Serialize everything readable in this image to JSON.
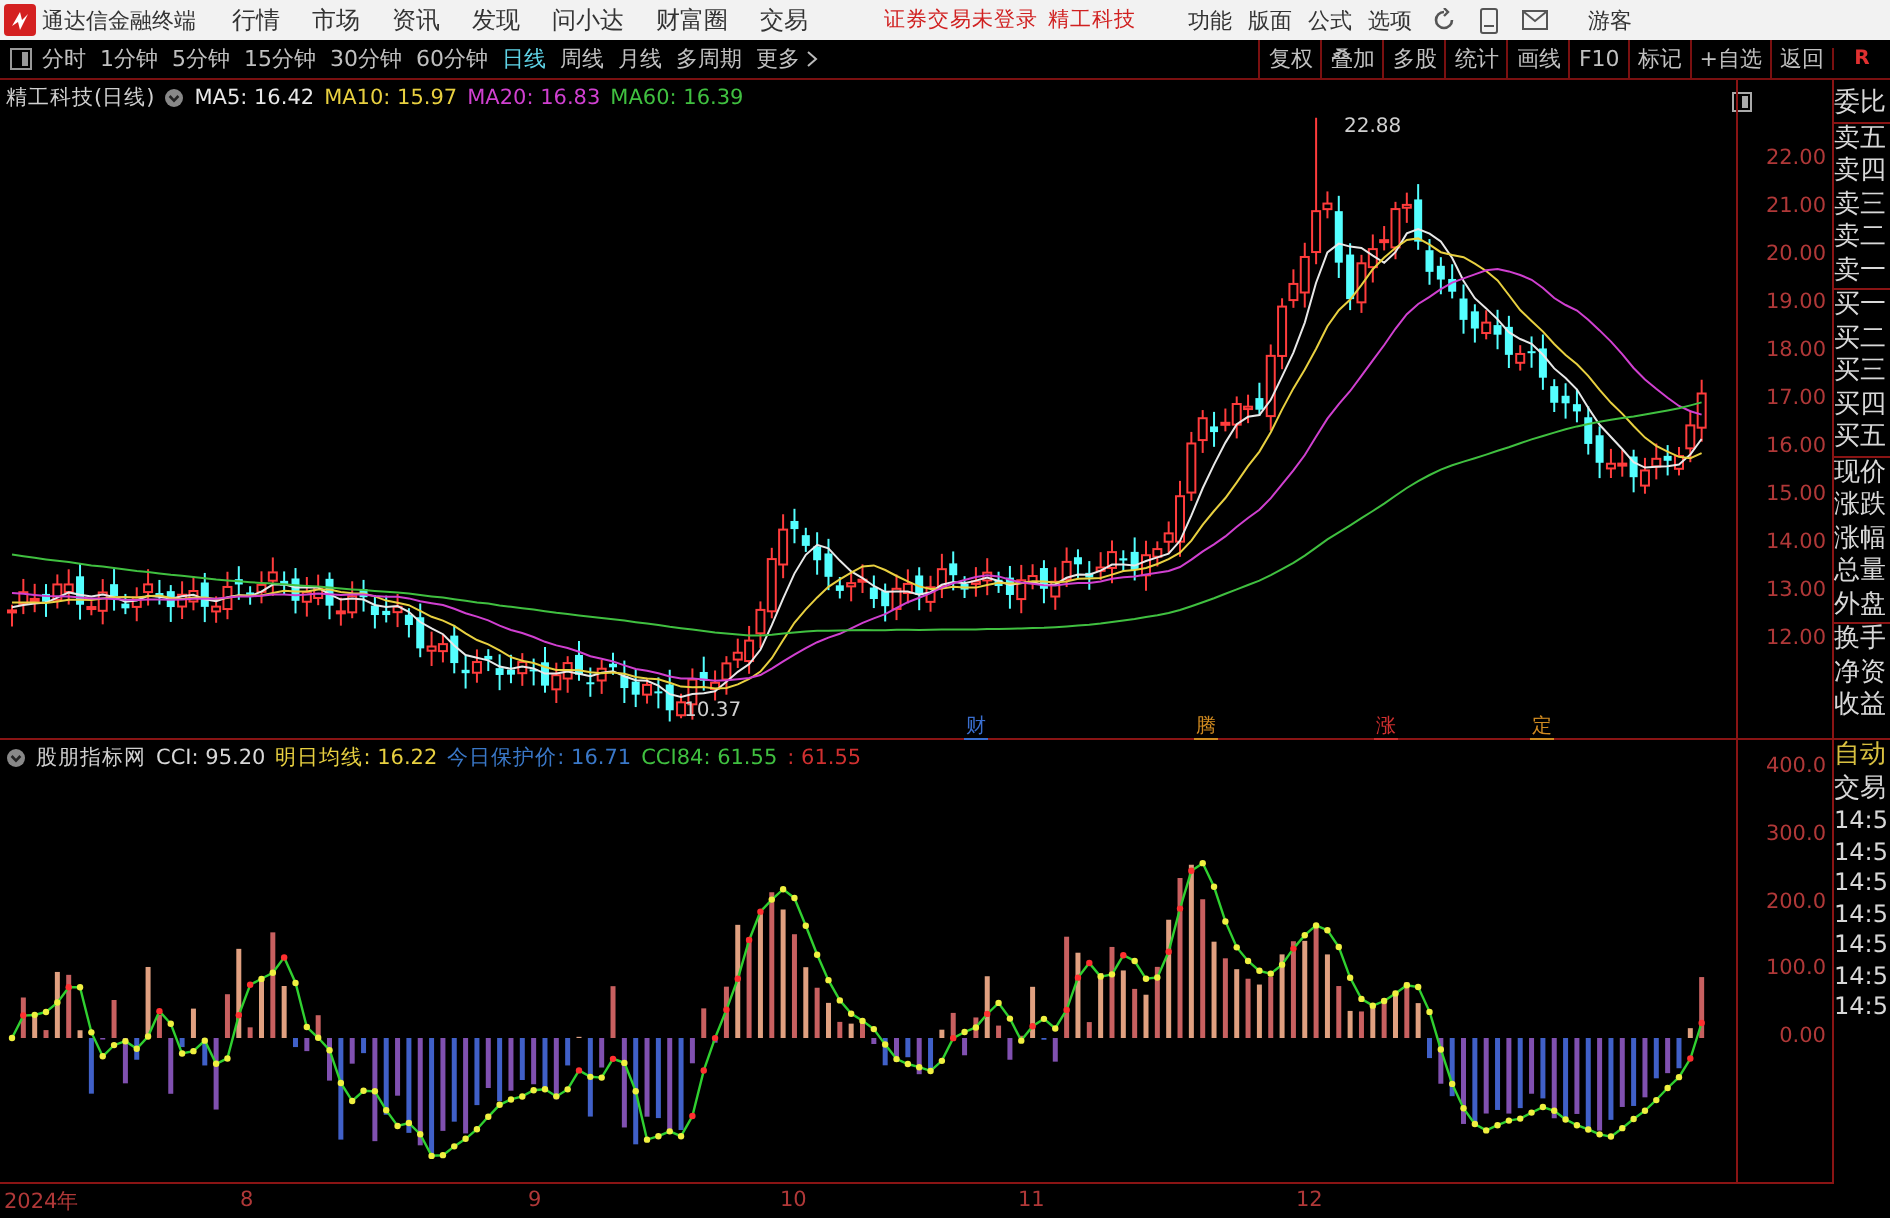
{
  "title_bar": {
    "app_name": "通达信金融终端",
    "menus": [
      "行情",
      "市场",
      "资讯",
      "发现",
      "问小达",
      "财富圈",
      "交易"
    ],
    "notice": "证券交易未登录",
    "stock": "精工科技",
    "right_menus": [
      "功能",
      "版面",
      "公式",
      "选项"
    ],
    "user": "游客"
  },
  "toolbar": {
    "periods": [
      {
        "label": "分时",
        "selected": false
      },
      {
        "label": "1分钟",
        "selected": false
      },
      {
        "label": "5分钟",
        "selected": false
      },
      {
        "label": "15分钟",
        "selected": false
      },
      {
        "label": "30分钟",
        "selected": false
      },
      {
        "label": "60分钟",
        "selected": false
      },
      {
        "label": "日线",
        "selected": true
      },
      {
        "label": "周线",
        "selected": false
      },
      {
        "label": "月线",
        "selected": false
      },
      {
        "label": "多周期",
        "selected": false
      },
      {
        "label": "更多",
        "selected": false
      }
    ],
    "buttons": [
      "复权",
      "叠加",
      "多股",
      "统计",
      "画线",
      "F10",
      "标记",
      "+自选",
      "返回"
    ],
    "r_mark": "R"
  },
  "chart": {
    "title": "精工科技(日线)",
    "ma": [
      {
        "label": "MA5: 16.42",
        "color": "#e8e8e8"
      },
      {
        "label": "MA10: 15.97",
        "color": "#e8d040"
      },
      {
        "label": "MA20: 16.83",
        "color": "#d040d0"
      },
      {
        "label": "MA60: 16.39",
        "color": "#40c040"
      }
    ],
    "price_ticks": [
      "22.00",
      "21.00",
      "20.00",
      "19.00",
      "18.00",
      "17.00",
      "16.00",
      "15.00",
      "14.00",
      "13.00",
      "12.00"
    ],
    "high_label": "22.88",
    "low_label": "10.37",
    "event_markers": [
      {
        "label": "财",
        "color": "#3a6fd0"
      },
      {
        "label": "腾",
        "color": "#d08a20"
      },
      {
        "label": "涨",
        "color": "#d03030"
      },
      {
        "label": "定",
        "color": "#d08a20"
      }
    ]
  },
  "indicator": {
    "name": "股朋指标网",
    "values": [
      {
        "label": "CCI: 95.20",
        "color": "#d8d8d8"
      },
      {
        "label": "明日均线: 16.22",
        "color": "#e8d040"
      },
      {
        "label": "今日保护价: 16.71",
        "color": "#3a78c8"
      },
      {
        "label": "CCI84: 61.55",
        "color": "#40c040"
      },
      {
        "label": ": 61.55",
        "color": "#d03030"
      }
    ],
    "ticks": [
      "400.0",
      "300.0",
      "200.0",
      "100.0",
      "0.00"
    ]
  },
  "time_axis": {
    "labels": [
      "2024年",
      "8",
      "9",
      "10",
      "11",
      "12"
    ]
  },
  "side_panel": {
    "quote_labels": [
      "委比",
      "卖五",
      "卖四",
      "卖三",
      "卖二",
      "卖一",
      "买一",
      "买二",
      "买三",
      "买四",
      "买五",
      "现价",
      "涨跌",
      "涨幅",
      "总量",
      "外盘",
      "换手",
      "净资",
      "收益"
    ],
    "indicator_labels": [
      "自动",
      "交易"
    ],
    "times": [
      "14:5",
      "14:5",
      "14:5",
      "14:5",
      "14:5",
      "14:5",
      "14:5"
    ]
  }
}
